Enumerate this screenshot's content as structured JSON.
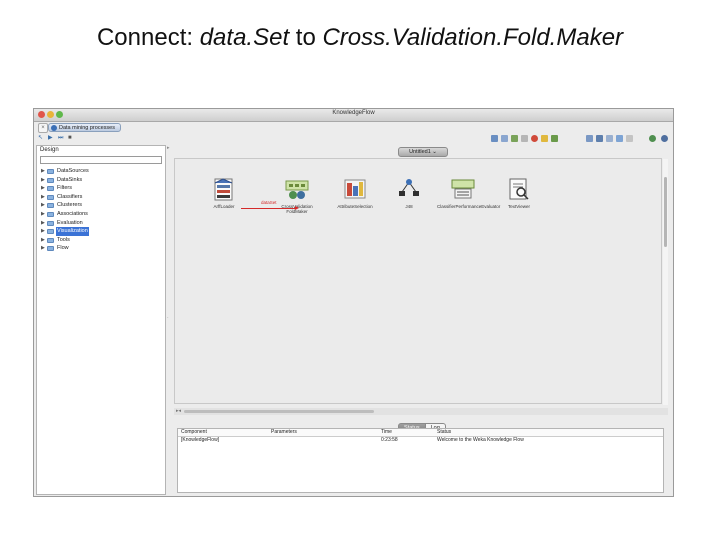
{
  "slide": {
    "title_prefix": "Connect: ",
    "title_emphasis": "data.Set",
    "title_middle": " to ",
    "title_target": "Cross.Validation.Fold.Maker"
  },
  "window": {
    "title": "KnowledgeFlow",
    "tab_label": "Data mining processes"
  },
  "left_panel": {
    "header": "Design",
    "search_value": "",
    "tree": [
      {
        "label": "DataSources",
        "selected": false
      },
      {
        "label": "DataSinks",
        "selected": false
      },
      {
        "label": "Filters",
        "selected": false
      },
      {
        "label": "Classifiers",
        "selected": false
      },
      {
        "label": "Clusterers",
        "selected": false
      },
      {
        "label": "Associations",
        "selected": false
      },
      {
        "label": "Evaluation",
        "selected": false
      },
      {
        "label": "Visualization",
        "selected": true
      },
      {
        "label": "Tools",
        "selected": false
      },
      {
        "label": "Flow",
        "selected": false
      }
    ]
  },
  "canvas": {
    "flow_tab": "Untitled1",
    "connection_label": "dataSet",
    "components": [
      {
        "label": "ArffLoader",
        "icon": "arff-loader-icon"
      },
      {
        "label": "CrossValidation FoldMaker",
        "icon": "cross-validation-icon"
      },
      {
        "label": "AttributeSelection",
        "icon": "attribute-selection-icon"
      },
      {
        "label": "J48",
        "icon": "j48-tree-icon"
      },
      {
        "label": "ClassifierPerformanceEvaluator",
        "icon": "performance-evaluator-icon"
      },
      {
        "label": "TextViewer",
        "icon": "text-viewer-icon"
      }
    ]
  },
  "bottom": {
    "status_tab": "Status",
    "log_tab": "Log",
    "columns": [
      "Component",
      "Parameters",
      "Time",
      "Status"
    ],
    "rows": [
      {
        "component": "[KnowledgeFlow]",
        "parameters": "",
        "time": "0:23:58",
        "status": "Welcome to the Weka Knowledge Flow"
      }
    ]
  },
  "colors": {
    "connection": "#d42a2a",
    "selection": "#3b73d6"
  }
}
